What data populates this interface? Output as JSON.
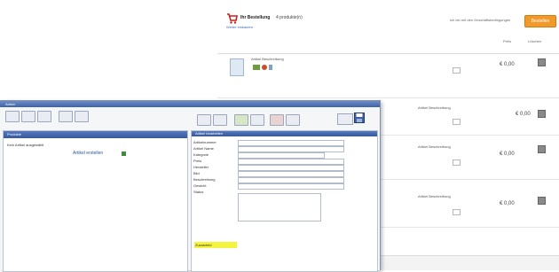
{
  "shop": {
    "header_title": "Ihr Bestellung",
    "header_sub": "4 produkte(n)",
    "header_link": "Weiter einkaufen",
    "header_right_text": "Ich bin mit den Geschäftsbedingungen",
    "order_button": "Bestellen",
    "columns": {
      "price": "Preis",
      "delete": "Löschen"
    },
    "rows": [
      {
        "desc": "Artikel Beschreibung",
        "price": "€ 0,00"
      },
      {
        "desc": "Artikel Beschreibung",
        "price": "€ 0,00"
      },
      {
        "desc": "Artikel Beschreibung",
        "price": "€ 0,00"
      },
      {
        "desc": "Artikel Beschreibung",
        "price": "€ 0,00"
      }
    ]
  },
  "app": {
    "title": "Admin",
    "left_panel": {
      "header": "Produkte",
      "message": "Kein Artikel ausgewählt",
      "link": "Artikel erstellen"
    },
    "right_panel": {
      "header": "Artikel bearbeiten",
      "fields": [
        "Artikelnummer",
        "Artikel Name",
        "Kategorie",
        "Preis",
        "Hersteller",
        "Bild",
        "Beschreibung",
        "Gewicht",
        "Status"
      ],
      "highlight_label": "Zusatzfeld"
    }
  },
  "colors": {
    "accent_orange": "#f19a2a",
    "window_blue": "#3e62a8",
    "highlight_yellow": "#f4f43c"
  }
}
